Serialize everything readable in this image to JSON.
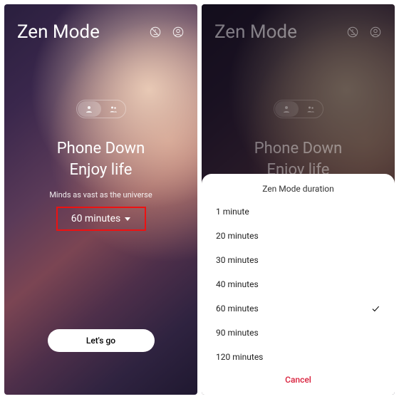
{
  "header": {
    "title": "Zen Mode"
  },
  "main": {
    "headline_line1": "Phone Down",
    "headline_line2": "Enjoy life",
    "subhead": "Minds as vast as the universe",
    "selected_duration": "60 minutes",
    "go_label": "Let's go"
  },
  "sheet": {
    "title": "Zen Mode duration",
    "options": [
      "1 minute",
      "20 minutes",
      "30 minutes",
      "40 minutes",
      "60 minutes",
      "90 minutes",
      "120 minutes"
    ],
    "selected_index": 4,
    "cancel_label": "Cancel"
  }
}
